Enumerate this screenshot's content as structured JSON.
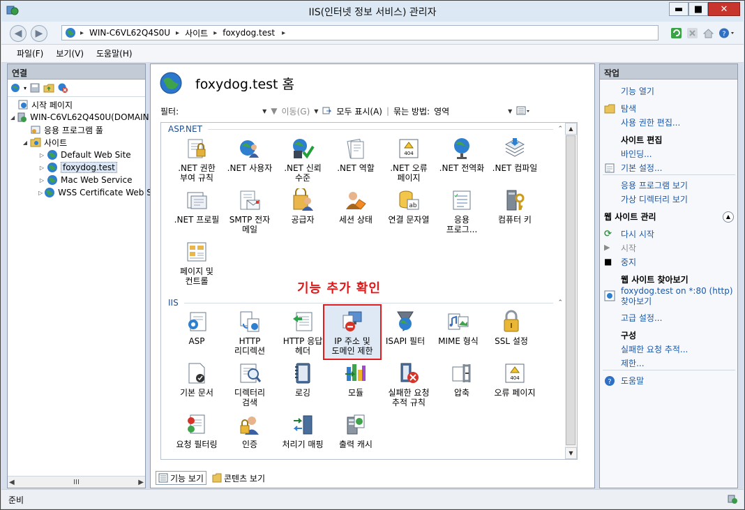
{
  "window": {
    "title": "IIS(인터넷 정보 서비스) 관리자",
    "minimize": "▬",
    "maximize": "■",
    "close": "✕"
  },
  "address": {
    "segments": [
      "WIN-C6VL62Q4S0U",
      "사이트",
      "foxydog.test"
    ],
    "separator": "▸"
  },
  "menu": [
    "파일(F)",
    "보기(V)",
    "도움말(H)"
  ],
  "connections": {
    "header": "연결",
    "tree": [
      {
        "label": "시작 페이지",
        "icon": "start-page-icon"
      },
      {
        "label": "WIN-C6VL62Q4S0U(DOMAIN",
        "icon": "server-icon"
      },
      {
        "label": "응용 프로그램 풀",
        "icon": "app-pool-icon"
      },
      {
        "label": "사이트",
        "icon": "sites-folder-icon"
      },
      {
        "label": "Default Web Site",
        "icon": "globe-icon"
      },
      {
        "label": "foxydog.test",
        "icon": "globe-icon"
      },
      {
        "label": "Mac Web Service",
        "icon": "globe-icon"
      },
      {
        "label": "WSS Certificate Web S",
        "icon": "globe-icon"
      }
    ],
    "scroll_mid": "III"
  },
  "home": {
    "title": "foxydog.test 홈"
  },
  "filter": {
    "label": "필터:",
    "go": "이동(G)",
    "show_all": "모두 표시(A)",
    "group_by_label": "묶는 방법:",
    "group_by_value": "영역"
  },
  "groups": {
    "aspnet": "ASP.NET",
    "iis": "IIS"
  },
  "aspnet_items": [
    {
      "label": ".NET 권한\n부여 규칙",
      "icon": "net-authorization-icon"
    },
    {
      "label": ".NET 사용자",
      "icon": "net-users-icon"
    },
    {
      "label": ".NET 신뢰\n수준",
      "icon": "net-trust-icon"
    },
    {
      "label": ".NET 역할",
      "icon": "net-roles-icon"
    },
    {
      "label": ".NET 오류\n페이지",
      "icon": "net-error-pages-icon"
    },
    {
      "label": ".NET 전역화",
      "icon": "net-globalization-icon"
    },
    {
      "label": ".NET 컴파일",
      "icon": "net-compilation-icon"
    },
    {
      "label": ".NET 프로필",
      "icon": "net-profile-icon"
    },
    {
      "label": "SMTP 전자\n메일",
      "icon": "smtp-email-icon"
    },
    {
      "label": "공급자",
      "icon": "providers-icon"
    },
    {
      "label": "세션 상태",
      "icon": "session-state-icon"
    },
    {
      "label": "연결 문자열",
      "icon": "connection-strings-icon"
    },
    {
      "label": "응용\n프로그...",
      "icon": "app-settings-icon"
    },
    {
      "label": "컴퓨터 키",
      "icon": "machine-key-icon"
    },
    {
      "label": "페이지 및\n컨트롤",
      "icon": "pages-controls-icon"
    }
  ],
  "iis_items": [
    {
      "label": "ASP",
      "icon": "asp-icon"
    },
    {
      "label": "HTTP\n리디렉션",
      "icon": "http-redirect-icon"
    },
    {
      "label": "HTTP 응답\n헤더",
      "icon": "http-response-headers-icon"
    },
    {
      "label": "IP 주소 및\n도메인 제한",
      "icon": "ip-domain-restrictions-icon"
    },
    {
      "label": "ISAPI 필터",
      "icon": "isapi-filters-icon"
    },
    {
      "label": "MIME 형식",
      "icon": "mime-types-icon"
    },
    {
      "label": "SSL 설정",
      "icon": "ssl-settings-icon"
    },
    {
      "label": "기본 문서",
      "icon": "default-document-icon"
    },
    {
      "label": "디렉터리\n검색",
      "icon": "directory-browsing-icon"
    },
    {
      "label": "로깅",
      "icon": "logging-icon"
    },
    {
      "label": "모듈",
      "icon": "modules-icon"
    },
    {
      "label": "실패한 요청\n추적 규칙",
      "icon": "failed-request-tracing-icon"
    },
    {
      "label": "압축",
      "icon": "compression-icon"
    },
    {
      "label": "오류 페이지",
      "icon": "error-pages-icon"
    },
    {
      "label": "요청 필터링",
      "icon": "request-filtering-icon"
    },
    {
      "label": "인증",
      "icon": "authentication-icon"
    },
    {
      "label": "처리기 매핑",
      "icon": "handler-mappings-icon"
    },
    {
      "label": "출력 캐시",
      "icon": "output-caching-icon"
    }
  ],
  "annotation": "기능 추가 확인",
  "view_tabs": {
    "features": "기능 보기",
    "content": "콘텐츠 보기"
  },
  "actions": {
    "header": "작업",
    "open_feature": "기능 열기",
    "explore": "탐색",
    "edit_permissions": "사용 권한 편집...",
    "edit_site_header": "사이트 편집",
    "bindings": "바인딩...",
    "basic_settings": "기본 설정...",
    "view_applications": "응용 프로그램 보기",
    "view_virtual_dirs": "가상 디렉터리 보기",
    "manage_site_header": "웹 사이트 관리",
    "restart": "다시 시작",
    "start": "시작",
    "stop": "중지",
    "browse_site_header": "웹 사이트 찾아보기",
    "browse_link": "foxydog.test on *:80 (http) 찾아보기",
    "advanced_settings": "고급 설정...",
    "configure_header": "구성",
    "failed_request_tracing": "실패한 요청 추적...",
    "limits": "제한...",
    "help": "도움말"
  },
  "status": {
    "text": "준비"
  },
  "colors": {
    "accent": "#1c57a8",
    "highlight": "#e01c1c",
    "group_header": "#1e4c8e"
  }
}
